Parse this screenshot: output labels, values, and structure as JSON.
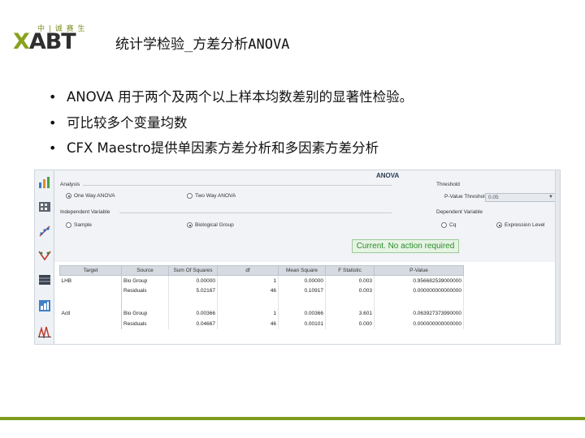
{
  "logo": {
    "subtitle": "中 | 诚 赛 生",
    "main_x": "X",
    "main_rest": "ABT"
  },
  "slide": {
    "title": "统计学检验_方差分析ANOVA",
    "bullets": [
      "ANOVA 用于两个及两个以上样本均数差别的显著性检验。",
      "可比较多个变量均数",
      "CFX Maestro提供单因素方差分析和多因素方差分析"
    ]
  },
  "app": {
    "panel_title": "ANOVA",
    "analysis": {
      "label": "Analysis",
      "options": [
        {
          "label": "One Way ANOVA",
          "selected": true
        },
        {
          "label": "Two Way ANOVA",
          "selected": false
        }
      ]
    },
    "independent": {
      "label": "Independent Variable",
      "options": [
        {
          "label": "Sample",
          "selected": false
        },
        {
          "label": "Biological Group",
          "selected": true
        }
      ]
    },
    "threshold": {
      "label": "Threshold",
      "pvalue_label": "P-Value Threshold:",
      "pvalue_value": "0.05"
    },
    "dependent": {
      "label": "Dependent Variable",
      "options": [
        {
          "label": "Cq",
          "selected": false
        },
        {
          "label": "Expression Level",
          "selected": true
        }
      ]
    },
    "status": "Current. No action required",
    "toolbar_icons": [
      "bar-chart-icon",
      "clustergram-icon",
      "scatter-icon",
      "volcano-icon",
      "heatmap-icon",
      "table-report-icon",
      "anova-icon"
    ],
    "table": {
      "columns": [
        "Target",
        "Source",
        "Sum Of Squares",
        "df",
        "Mean Square",
        "F Statistic",
        "P-Value"
      ],
      "rows": [
        [
          "LHB",
          "Bio Group",
          "0.00000",
          "1",
          "0.00000",
          "0.003",
          "0.956682539000000"
        ],
        [
          "",
          "Residuals",
          "5.02167",
          "46",
          "0.10917",
          "0.003",
          "0.000000000000000"
        ],
        [
          "Actl",
          "Bio Group",
          "0.00366",
          "1",
          "0.00366",
          "3.601",
          "0.063927373990000"
        ],
        [
          "",
          "Residuals",
          "0.04667",
          "46",
          "0.00101",
          "0.000",
          "0.000000000000000"
        ]
      ]
    }
  }
}
